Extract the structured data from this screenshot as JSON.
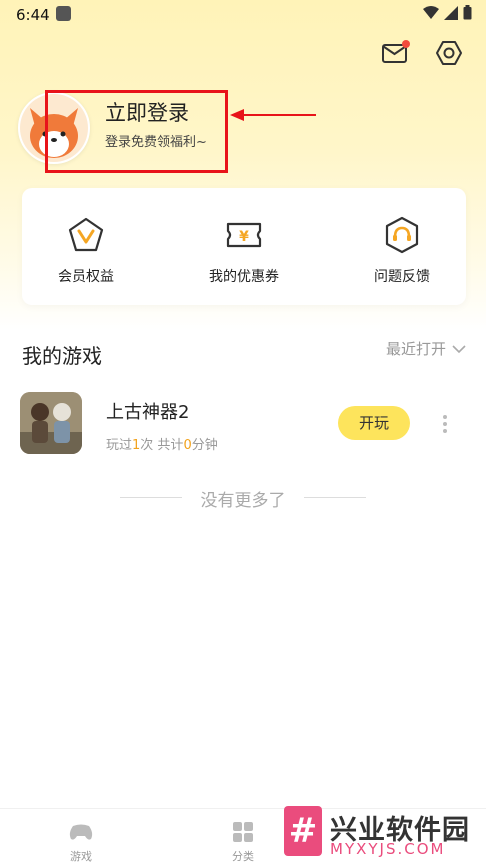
{
  "status_bar": {
    "time": "6:44"
  },
  "profile": {
    "title": "立即登录",
    "subtitle": "登录免费领福利~"
  },
  "quick_actions": [
    {
      "label": "会员权益",
      "icon": "vip-pentagon-icon"
    },
    {
      "label": "我的优惠券",
      "icon": "coupon-ticket-icon"
    },
    {
      "label": "问题反馈",
      "icon": "headset-support-icon"
    }
  ],
  "my_games": {
    "title": "我的游戏",
    "sort_label": "最近打开",
    "games": [
      {
        "name": "上古神器2",
        "meta_prefix": "玩过",
        "play_count": "1",
        "meta_mid": "次 共计",
        "minutes": "0",
        "meta_suffix": "分钟",
        "play_label": "开玩"
      }
    ],
    "end_text": "没有更多了"
  },
  "tabs": [
    {
      "label": "游戏",
      "icon": "gamepad-icon"
    },
    {
      "label": "分类",
      "icon": "grid-category-icon"
    }
  ],
  "watermark": {
    "cn": "兴业软件园",
    "en": "MYXYJS.COM",
    "logo": "#"
  },
  "colors": {
    "accent_yellow": "#fde45c",
    "highlight_red": "#e8131a",
    "orange_number": "#f2a21c"
  }
}
